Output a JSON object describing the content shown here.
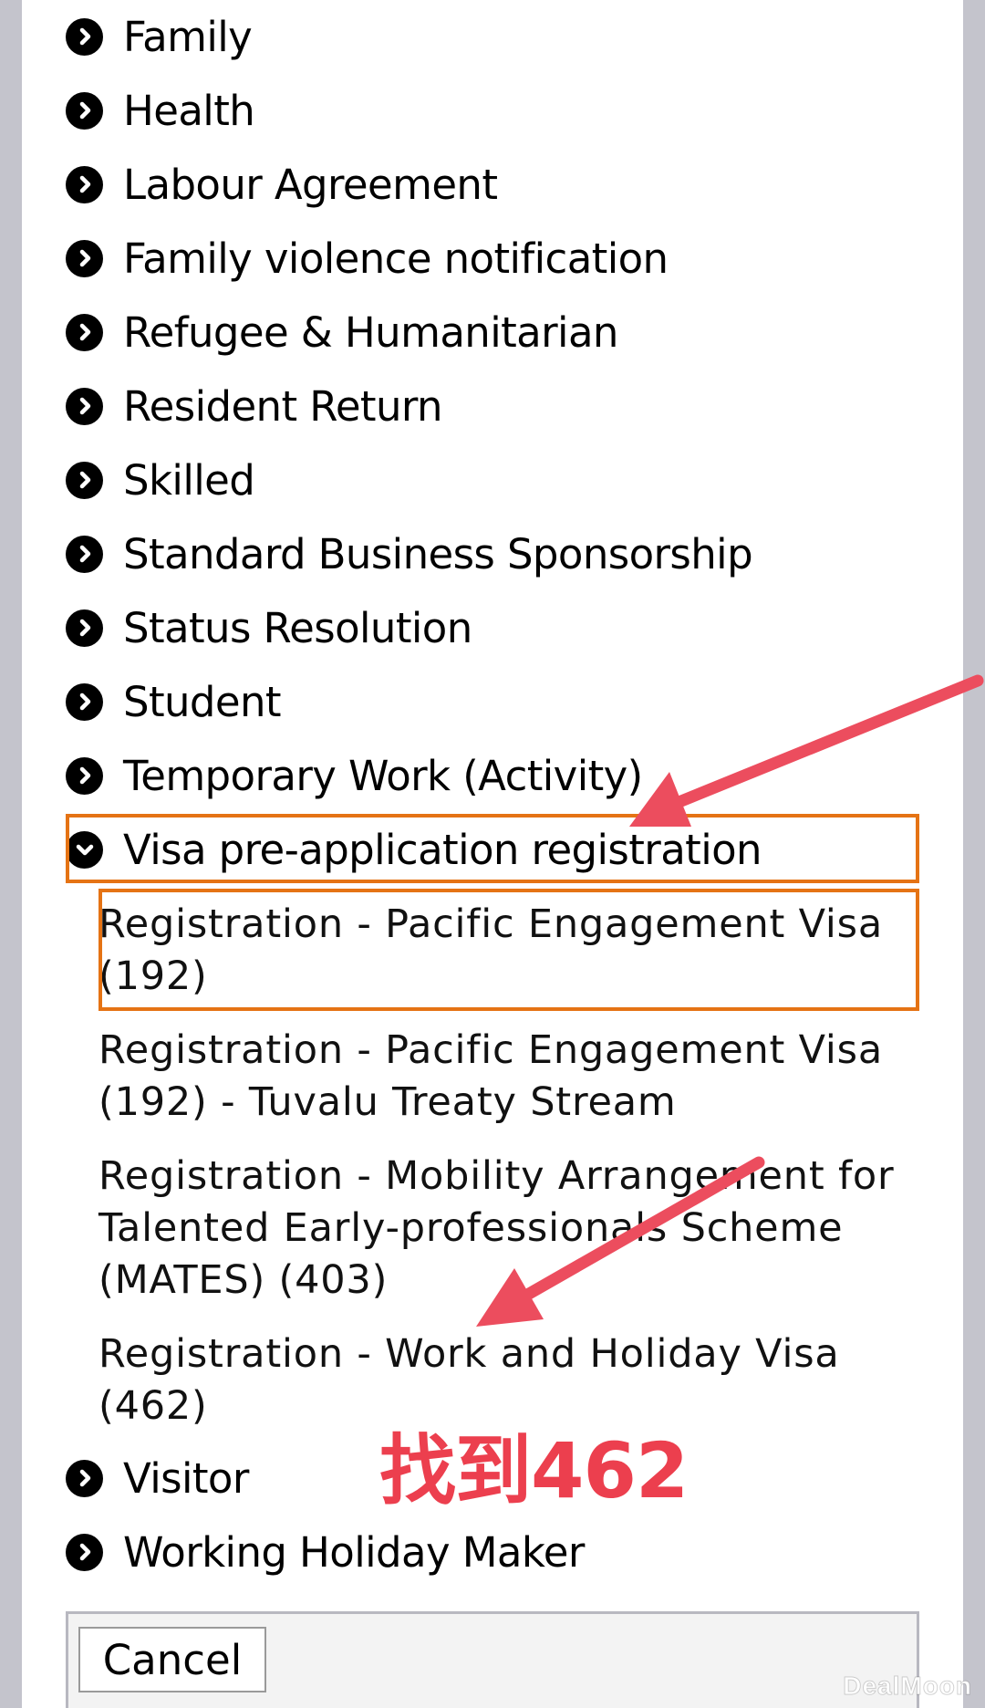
{
  "categories": [
    {
      "label": "Family",
      "expanded": false
    },
    {
      "label": "Health",
      "expanded": false
    },
    {
      "label": "Labour Agreement",
      "expanded": false
    },
    {
      "label": "Family violence notification",
      "expanded": false
    },
    {
      "label": "Refugee & Humanitarian",
      "expanded": false
    },
    {
      "label": "Resident Return",
      "expanded": false
    },
    {
      "label": "Skilled",
      "expanded": false
    },
    {
      "label": "Standard Business Sponsorship",
      "expanded": false
    },
    {
      "label": "Status Resolution",
      "expanded": false
    },
    {
      "label": "Student",
      "expanded": false
    },
    {
      "label": "Temporary Work (Activity)",
      "expanded": false
    },
    {
      "label": "Visa pre-application registration",
      "expanded": true
    },
    {
      "label": "Visitor",
      "expanded": false
    },
    {
      "label": "Working Holiday Maker",
      "expanded": false
    }
  ],
  "sub_items": [
    "Registration - Pacific Engagement Visa (192)",
    "Registration - Pacific Engagement Visa (192) - Tuvalu Treaty Stream",
    "Registration - Mobility Arrangement for Talented Early-professionals Scheme (MATES) (403)",
    "Registration - Work and Holiday Visa (462)"
  ],
  "annotation": "找到462",
  "cancel_label": "Cancel",
  "watermark": "DealMoon",
  "colors": {
    "highlight_box": "#e57314",
    "arrow": "#ec4d5e",
    "annotation_text": "#ec3f4e"
  },
  "icons": {
    "collapsed": "chevron-right-circle-icon",
    "expanded": "chevron-down-circle-icon"
  }
}
